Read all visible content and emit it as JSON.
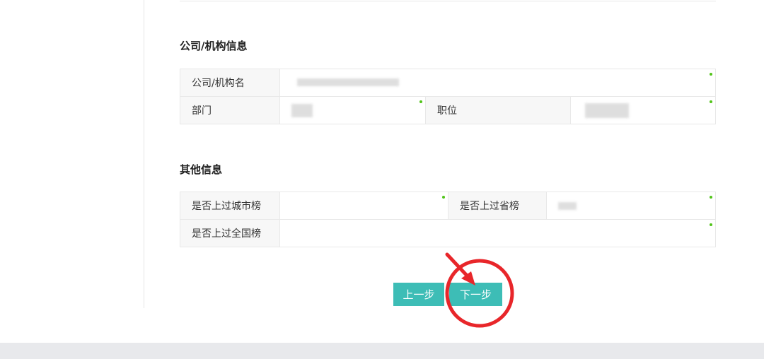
{
  "company_section": {
    "title": "公司/机构信息",
    "company_name_label": "公司/机构名",
    "department_label": "部门",
    "position_label": "职位"
  },
  "other_section": {
    "title": "其他信息",
    "city_rank_label": "是否上过城市榜",
    "province_rank_label": "是否上过省榜",
    "national_rank_label": "是否上过全国榜"
  },
  "buttons": {
    "prev_label": "上一步",
    "next_label": "下一步"
  },
  "colors": {
    "button": "#3dbdb6",
    "required_dot": "#52c41a",
    "annotation": "#e8262a"
  }
}
